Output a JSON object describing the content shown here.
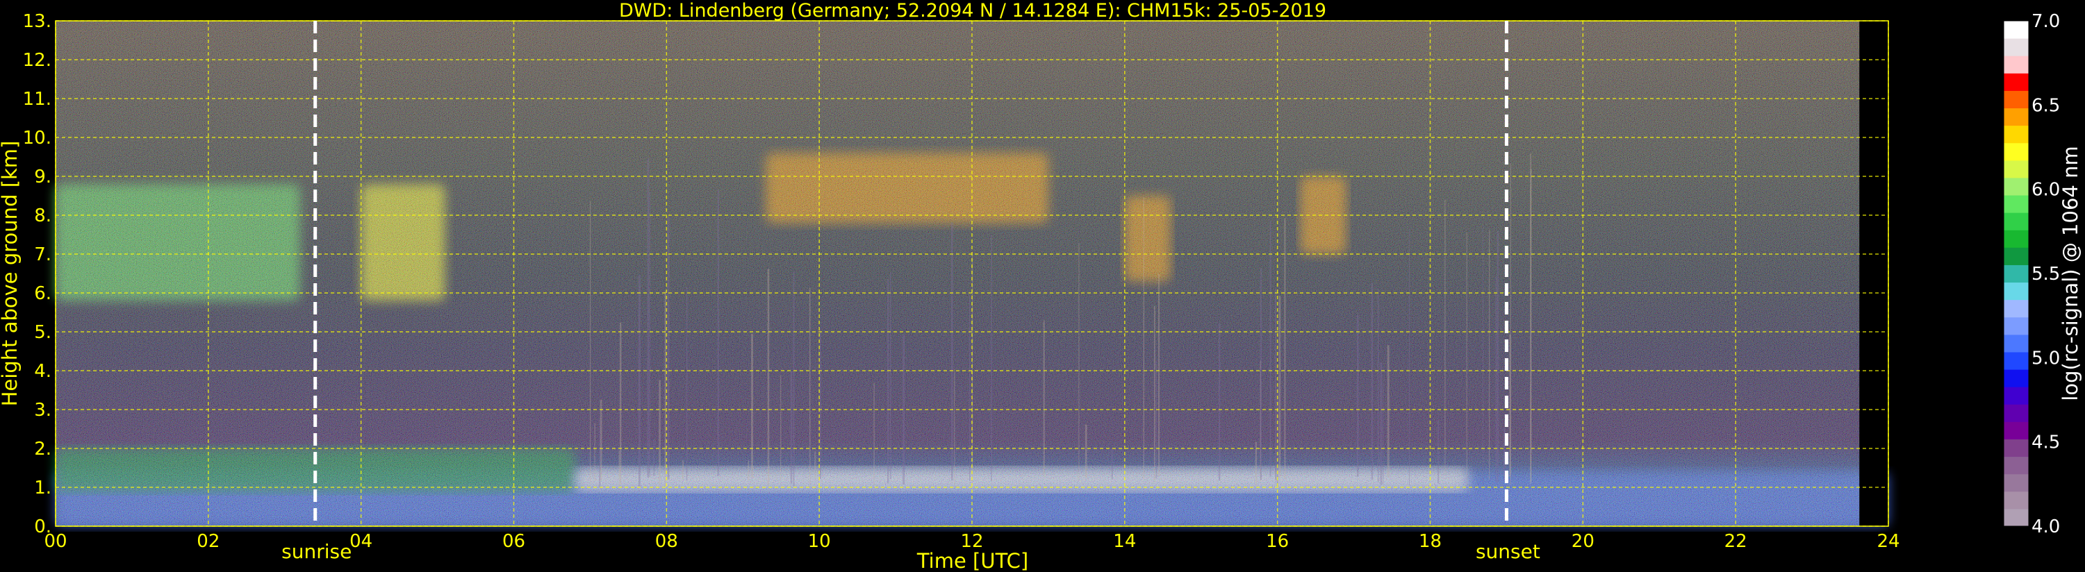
{
  "chart_data": {
    "type": "heatmap",
    "title": "DWD: Lindenberg (Germany; 52.2094 N / 14.1284 E):    CHM15k: 25-05-2019",
    "xlabel": "Time [UTC]",
    "ylabel": "Height above ground [km]",
    "xlim": [
      0,
      24
    ],
    "ylim": [
      0,
      13
    ],
    "x_ticks": [
      "00",
      "02",
      "04",
      "06",
      "08",
      "10",
      "12",
      "14",
      "16",
      "18",
      "20",
      "22",
      "24"
    ],
    "y_ticks": [
      "0.",
      "1.",
      "2.",
      "3.",
      "4.",
      "5.",
      "6.",
      "7.",
      "8.",
      "9.",
      "10.",
      "11.",
      "12.",
      "13."
    ],
    "grid": true,
    "grid_color": "#ffff00",
    "events": [
      {
        "label": "sunrise",
        "time_utc": 3.4
      },
      {
        "label": "sunset",
        "time_utc": 19.0
      }
    ],
    "no_data_from_utc": 23.62,
    "colorbar": {
      "label": "log(rc-signal) @ 1064 nm",
      "min": 4.0,
      "max": 7.0,
      "ticks": [
        "4.0",
        "4.5",
        "5.0",
        "5.5",
        "6.0",
        "6.5",
        "7.0"
      ],
      "colors": [
        "#b0a0b4",
        "#a890a8",
        "#98789c",
        "#8c6094",
        "#80408c",
        "#780098",
        "#6000b0",
        "#4000d0",
        "#1010f0",
        "#2048ff",
        "#4c78ff",
        "#7c9cff",
        "#a0b8ff",
        "#68d8e8",
        "#30b8a8",
        "#109840",
        "#18b830",
        "#30d048",
        "#60e860",
        "#a0f070",
        "#d8f848",
        "#ffff20",
        "#ffd800",
        "#ffa000",
        "#ff6000",
        "#ff0000",
        "#ffc8cc",
        "#e8e0e4",
        "#ffffff"
      ]
    },
    "features": [
      {
        "name": "boundary layer aerosol",
        "time_utc": [
          0,
          24
        ],
        "height_km": [
          0,
          1.4
        ],
        "level": 5.1
      },
      {
        "name": "residual layer",
        "time_utc": [
          0,
          6.8
        ],
        "height_km": [
          0.9,
          2.0
        ],
        "level": 5.6
      },
      {
        "name": "cirrus early",
        "time_utc": [
          0,
          3.2
        ],
        "height_km": [
          5.8,
          8.8
        ],
        "level": 5.9
      },
      {
        "name": "cirrus 04-05 UTC",
        "time_utc": [
          4.0,
          5.1
        ],
        "height_km": [
          5.8,
          8.8
        ],
        "level": 6.3
      },
      {
        "name": "cirrus 09-13 UTC",
        "time_utc": [
          9.3,
          13.0
        ],
        "height_km": [
          7.8,
          9.6
        ],
        "level": 6.5
      },
      {
        "name": "cirrus 14-15 UTC",
        "time_utc": [
          14.0,
          14.6
        ],
        "height_km": [
          6.3,
          8.5
        ],
        "level": 6.5
      },
      {
        "name": "cirrus 16-17 UTC",
        "time_utc": [
          16.3,
          16.9
        ],
        "height_km": [
          7.0,
          9.0
        ],
        "level": 6.5
      },
      {
        "name": "cumulus cloud base",
        "time_utc": [
          6.8,
          18.5
        ],
        "height_km": [
          0.9,
          1.5
        ],
        "level": 7.0
      }
    ]
  }
}
